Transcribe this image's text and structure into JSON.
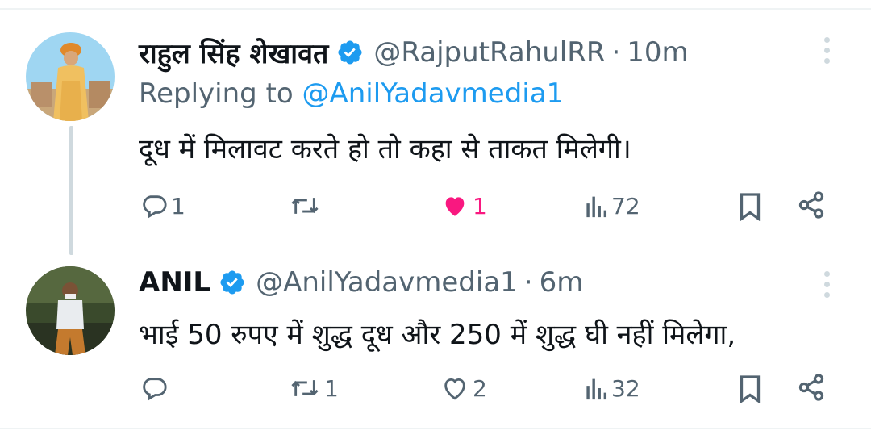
{
  "tweets": [
    {
      "name": "राहुल सिंह शेखावत",
      "handle": "@RajputRahulRR",
      "separator": "·",
      "time": "10m",
      "replying_prefix": "Replying to ",
      "replying_to": "@AnilYadavmedia1",
      "text": "दूध में मिलावट करते हो तो कहा से ताकत मिलेगी।",
      "replies": "1",
      "retweets": "",
      "likes": "1",
      "views": "72",
      "liked": true
    },
    {
      "name": "ANIL",
      "handle": "@AnilYadavmedia1",
      "separator": "·",
      "time": "6m",
      "text": "भाई  50 रुपए में शुद्ध दूध और 250 में शुद्ध घी नहीं मिलेगा,",
      "replies": "",
      "retweets": "1",
      "likes": "2",
      "views": "32",
      "liked": false
    }
  ],
  "colors": {
    "verified": "#1d9bf0",
    "muted": "#536471",
    "like_active": "#f91880",
    "mention": "#1d9bf0"
  },
  "icons": [
    "verified-icon",
    "more-icon",
    "reply-icon",
    "retweet-icon",
    "like-icon",
    "views-icon",
    "bookmark-icon",
    "share-icon"
  ]
}
